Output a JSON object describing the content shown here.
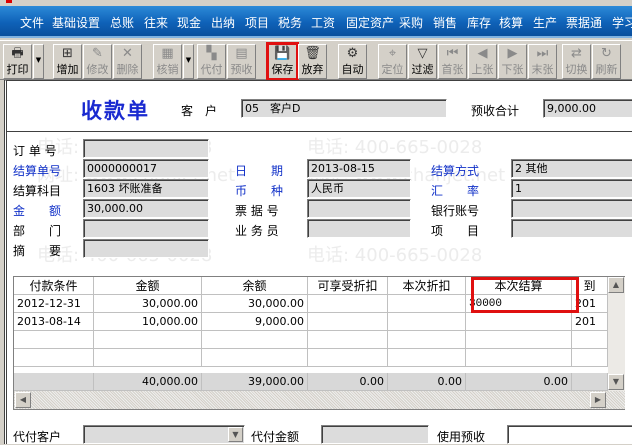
{
  "menu": [
    "文件",
    "基础设置",
    "总账",
    "往来",
    "现金",
    "出纳",
    "项目",
    "税务",
    "工资",
    "固定资产",
    "采购",
    "销售",
    "库存",
    "核算",
    "生产",
    "票据通",
    "学习"
  ],
  "toolbar": [
    {
      "label": "打印",
      "icon": "printer-icon",
      "glyph": "🖶",
      "enabled": true
    },
    {
      "label": "增加",
      "icon": "add-document-icon",
      "glyph": "⊞",
      "enabled": true
    },
    {
      "label": "修改",
      "icon": "edit-icon",
      "glyph": "✎",
      "enabled": false
    },
    {
      "label": "删除",
      "icon": "delete-icon",
      "glyph": "✕",
      "enabled": false
    },
    {
      "label": "核销",
      "icon": "verify-icon",
      "glyph": "▦",
      "enabled": false
    },
    {
      "label": "代付",
      "icon": "proxy-pay-icon",
      "glyph": "▚",
      "enabled": false
    },
    {
      "label": "预收",
      "icon": "prepay-icon",
      "glyph": "▤",
      "enabled": false
    },
    {
      "label": "保存",
      "icon": "save-icon",
      "glyph": "💾",
      "enabled": true
    },
    {
      "label": "放弃",
      "icon": "discard-icon",
      "glyph": "🗑",
      "enabled": true
    },
    {
      "label": "自动",
      "icon": "auto-icon",
      "glyph": "⚙",
      "enabled": true
    },
    {
      "label": "定位",
      "icon": "locate-icon",
      "glyph": "⌖",
      "enabled": false
    },
    {
      "label": "过滤",
      "icon": "filter-icon",
      "glyph": "▽",
      "enabled": true
    },
    {
      "label": "首张",
      "icon": "first-record-icon",
      "glyph": "⏮",
      "enabled": false
    },
    {
      "label": "上张",
      "icon": "previous-record-icon",
      "glyph": "◀",
      "enabled": false
    },
    {
      "label": "下张",
      "icon": "next-record-icon",
      "glyph": "▶",
      "enabled": false
    },
    {
      "label": "末张",
      "icon": "last-record-icon",
      "glyph": "⏭",
      "enabled": false
    },
    {
      "label": "切换",
      "icon": "switch-icon",
      "glyph": "⇄",
      "enabled": false
    },
    {
      "label": "刷新",
      "icon": "refresh-icon",
      "glyph": "↻",
      "enabled": false
    }
  ],
  "header": {
    "title": "收款单",
    "customer_label": "客　户",
    "customer_value": "05　客户D",
    "prepay_total_label": "预收合计",
    "prepay_total_value": "9,000.00"
  },
  "form": {
    "order_no": {
      "label": "订 单 号",
      "value": ""
    },
    "settle_no": {
      "label": "结算单号",
      "value": "0000000017"
    },
    "date": {
      "label": "日　　期",
      "value": "2013-08-15"
    },
    "settle_method": {
      "label": "结算方式",
      "value": "2  其他"
    },
    "settle_account": {
      "label": "结算科目",
      "value": "1603  坏账准备"
    },
    "currency": {
      "label": "币　　种",
      "value": "人民币"
    },
    "rate": {
      "label": "汇　　率",
      "value": "1"
    },
    "amount": {
      "label": "金　　额",
      "value": "30,000.00"
    },
    "bill_no": {
      "label": "票 据 号",
      "value": ""
    },
    "bank_account": {
      "label": "银行账号",
      "value": ""
    },
    "department": {
      "label": "部　　门",
      "value": ""
    },
    "salesman": {
      "label": "业 务 员",
      "value": ""
    },
    "project": {
      "label": "项　　目",
      "value": ""
    },
    "summary": {
      "label": "摘　　要",
      "value": ""
    }
  },
  "grid": {
    "columns": [
      "付款条件",
      "金额",
      "余额",
      "可享受折扣",
      "本次折扣",
      "本次结算",
      "到"
    ],
    "rows": [
      [
        "2012-12-31",
        "30,000.00",
        "30,000.00",
        "",
        "",
        "30000",
        "201"
      ],
      [
        "2013-08-14",
        "10,000.00",
        "9,000.00",
        "",
        "",
        "",
        "201"
      ]
    ],
    "totals": [
      "",
      "40,000.00",
      "39,000.00",
      "0.00",
      "0.00",
      "0.00",
      ""
    ]
  },
  "footer": {
    "proxy_customer_label": "代付客户",
    "proxy_customer_value": "",
    "proxy_amount_label": "代付金额",
    "proxy_amount_value": "",
    "use_prepay_label": "使用预收",
    "use_prepay_value": ""
  },
  "watermark": {
    "phone": "电话: 400-665-0028",
    "site": "网址: www.chanjet.net"
  }
}
